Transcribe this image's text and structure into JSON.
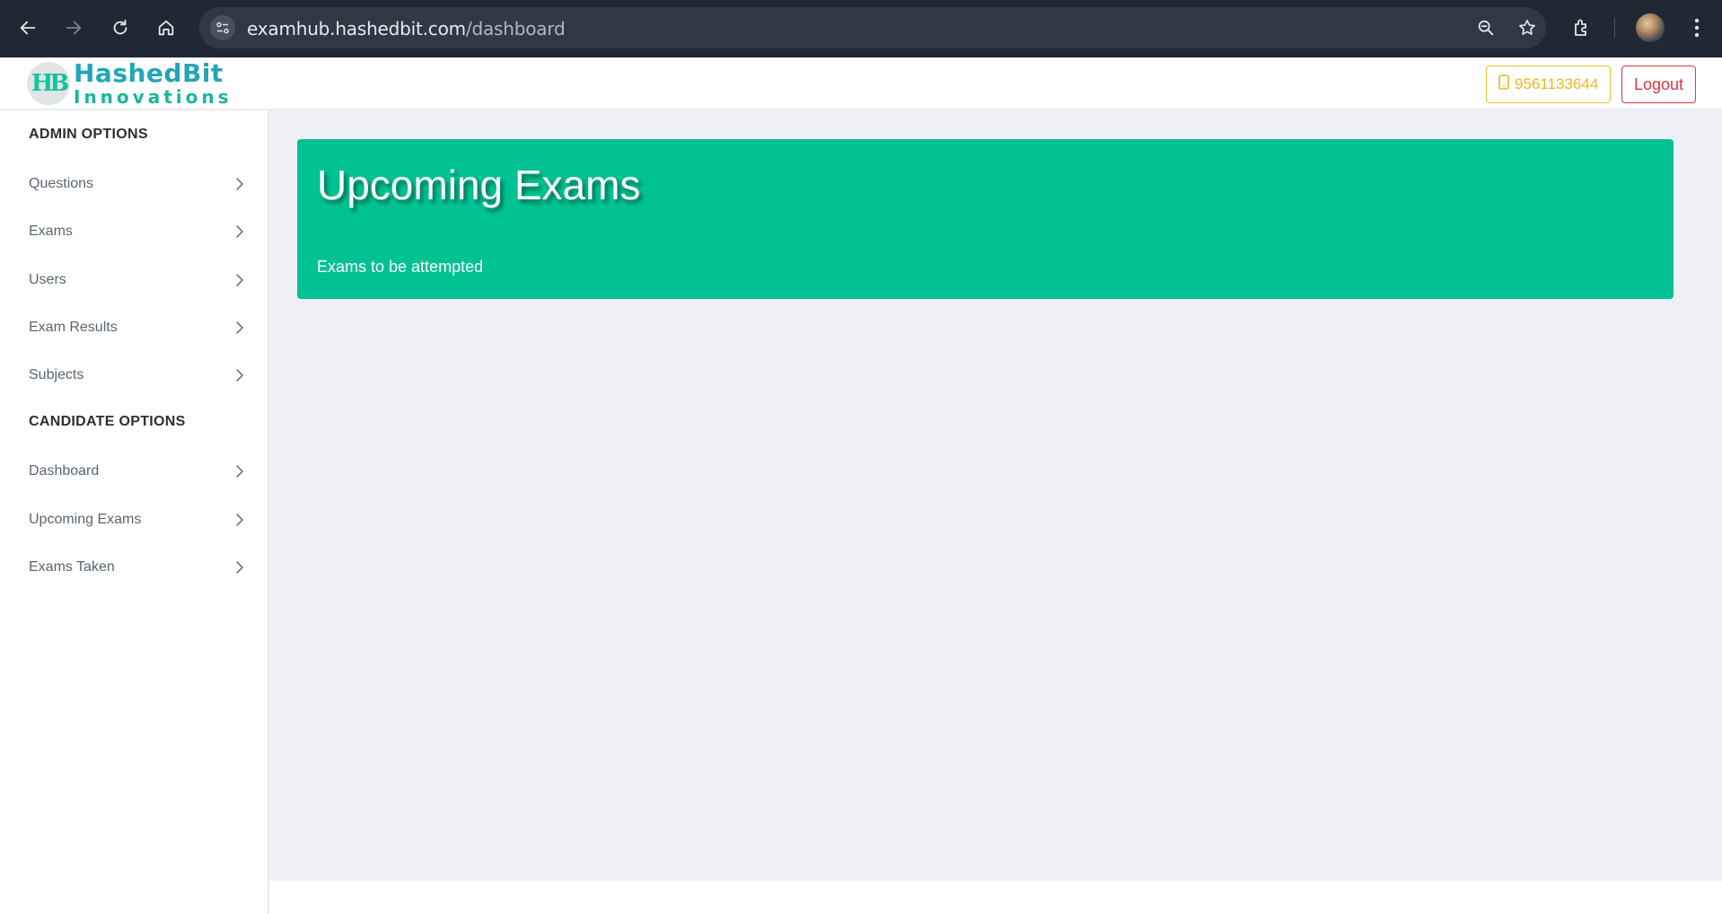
{
  "browser": {
    "url_domain": "examhub.hashedbit.com",
    "url_path": "/dashboard",
    "icons": [
      "back-icon",
      "forward-icon",
      "reload-icon",
      "home-icon",
      "site-settings-icon",
      "zoom-icon",
      "bookmark-star-icon",
      "extensions-icon",
      "profile-avatar",
      "menu-kebab-icon"
    ]
  },
  "header": {
    "logo_mark": "HB",
    "logo_line1": "HashedBit",
    "logo_line2": "Innovations",
    "phone": "9561133644",
    "logout": "Logout"
  },
  "sidebar": {
    "admin_heading": "ADMIN OPTIONS",
    "admin_items": [
      {
        "label": "Questions"
      },
      {
        "label": "Exams"
      },
      {
        "label": "Users"
      },
      {
        "label": "Exam Results"
      },
      {
        "label": "Subjects"
      }
    ],
    "candidate_heading": "CANDIDATE OPTIONS",
    "candidate_items": [
      {
        "label": "Dashboard"
      },
      {
        "label": "Upcoming Exams"
      },
      {
        "label": "Exams Taken"
      }
    ]
  },
  "main": {
    "title": "Upcoming Exams",
    "subtitle": "Exams to be attempted"
  },
  "colors": {
    "accent": "#00c292",
    "warning": "#efb91c",
    "danger": "#dd3545"
  }
}
